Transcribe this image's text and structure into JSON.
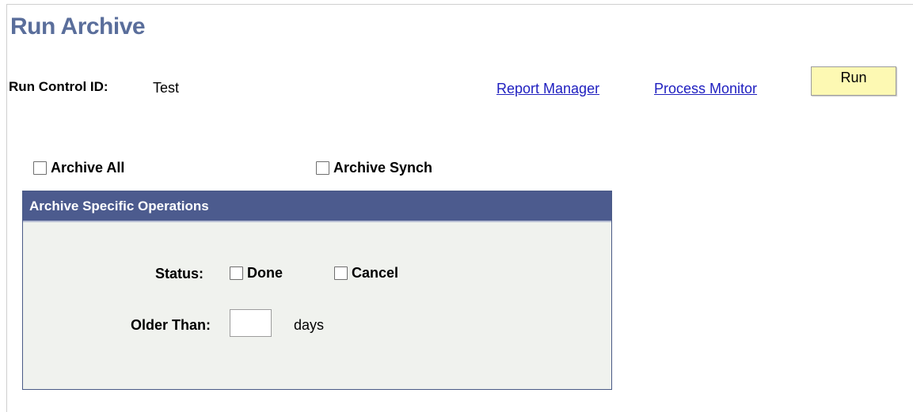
{
  "page": {
    "title": "Run Archive"
  },
  "run_control": {
    "label": "Run Control ID:",
    "value": "Test"
  },
  "links": {
    "report_manager": "Report Manager",
    "process_monitor": "Process Monitor"
  },
  "toolbar": {
    "run_label": "Run"
  },
  "options": {
    "archive_all": {
      "label": "Archive All",
      "checked": false
    },
    "archive_synch": {
      "label": "Archive Synch",
      "checked": false
    }
  },
  "specific_operations": {
    "title": "Archive Specific Operations",
    "status_label": "Status:",
    "done": {
      "label": "Done",
      "checked": false
    },
    "cancel": {
      "label": "Cancel",
      "checked": false
    },
    "older_than_label": "Older Than:",
    "older_than_value": "",
    "days_unit": "days"
  },
  "colors": {
    "title": "#5a6e9b",
    "link": "#2020c0",
    "run_button_bg": "#fdf9b3",
    "group_header_bg": "#4c5b8e",
    "group_body_bg": "#f0f2ee"
  }
}
